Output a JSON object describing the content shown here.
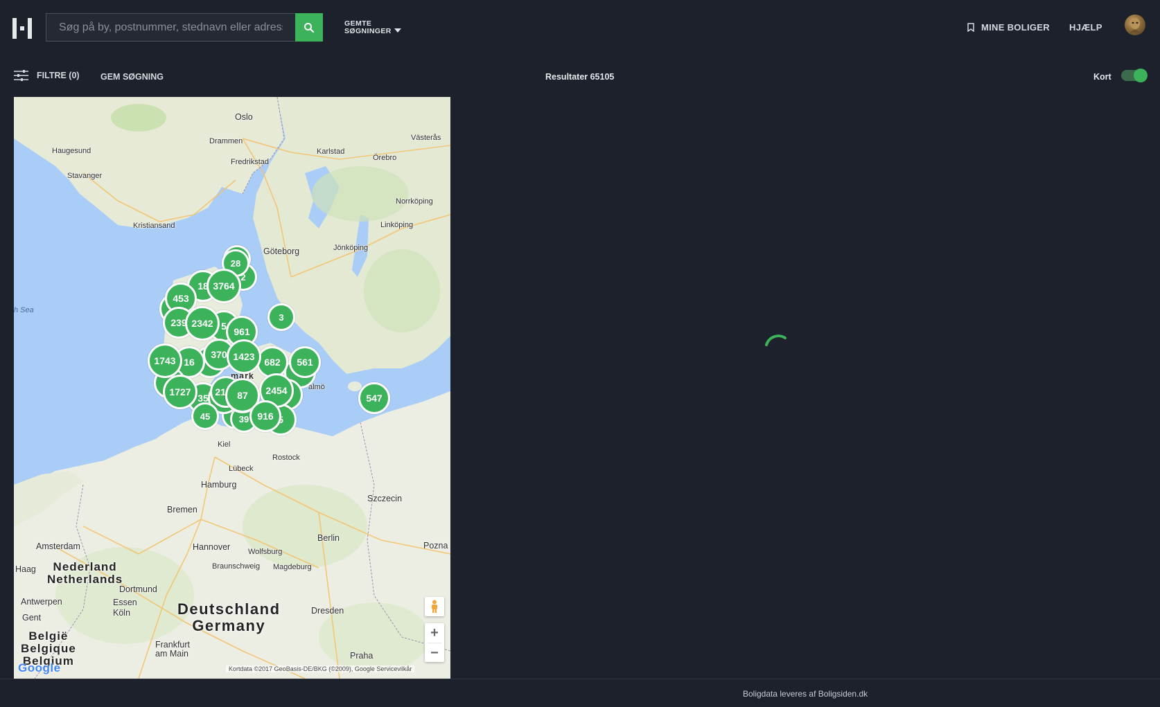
{
  "header": {
    "search_placeholder": "Søg på by, postnummer, stednavn eller adresse",
    "saved_searches_line1": "GEMTE",
    "saved_searches_line2": "SØGNINGER",
    "my_homes": "MINE BOLIGER",
    "help": "HJÆLP"
  },
  "toolbar": {
    "filters": "FILTRE (0)",
    "save_search": "GEM SØGNING",
    "results": "Resultater 65105",
    "map_toggle_label": "Kort",
    "map_toggle_on": true
  },
  "map": {
    "cities": {
      "oslo": "Oslo",
      "drammen": "Drammen",
      "fredrikstad": "Fredrikstad",
      "haugesund": "Haugesund",
      "stavanger": "Stavanger",
      "kristiansand": "Kristiansand",
      "karlstad": "Karlstad",
      "orebro": "Örebro",
      "vasteras": "Västerås",
      "norrkoping": "Norrköping",
      "linkoping": "Linköping",
      "jonkoping": "Jönköping",
      "goteborg": "Göteborg",
      "malmo": "almö",
      "kiel": "Kiel",
      "lubeck": "Lübeck",
      "rostock": "Rostock",
      "hamburg": "Hamburg",
      "szczecin": "Szczecin",
      "bremen": "Bremen",
      "amsterdam": "Amsterdam",
      "haag": "Haag",
      "hannover": "Hannover",
      "wolfsburg": "Wolfsburg",
      "berlin": "Berlin",
      "poznan": "Pozna",
      "braunschweig": "Braunschweig",
      "magdeburg": "Magdeburg",
      "dortmund": "Dortmund",
      "antwerpen": "Antwerpen",
      "essen": "Essen",
      "koln": "Köln",
      "gent": "Gent",
      "dresden": "Dresden",
      "frankfurt": "Frankfurt am Main",
      "praha": "Praha",
      "denmark_partial": "mark"
    },
    "countries": {
      "nl1": "Nederland",
      "nl2": "Netherlands",
      "de1": "Deutschland",
      "de2": "Germany",
      "be1": "België",
      "be2": "Belgique",
      "be3": "Belgium"
    },
    "sea_label": "h Sea",
    "clusters": [
      "28",
      "3764",
      "2",
      "18",
      "453",
      "9",
      "239",
      "2342",
      "5",
      "3",
      "961",
      "370",
      "1423",
      "1743",
      "16",
      "6",
      "682",
      "561",
      "2",
      "1727",
      "35",
      "36",
      "2137",
      "2454",
      "87",
      "45",
      "3",
      "39",
      "916",
      "5",
      "547"
    ],
    "zoom_in": "+",
    "zoom_out": "−",
    "google_logo": "Google",
    "attribution": "Kortdata ©2017 GeoBasis-DE/BKG (©2009), Google    Servicevilkår"
  },
  "footer": {
    "text": "Boligdata leveres af Boligsiden.dk"
  },
  "colors": {
    "background": "#1d212b",
    "accent_green": "#3cb25a",
    "water": "#a9cdf6"
  },
  "icons": [
    "logo-icon",
    "search-icon",
    "caret-down-icon",
    "bookmark-icon",
    "filter-sliders-icon",
    "pegman-icon",
    "loading-spinner-icon"
  ]
}
